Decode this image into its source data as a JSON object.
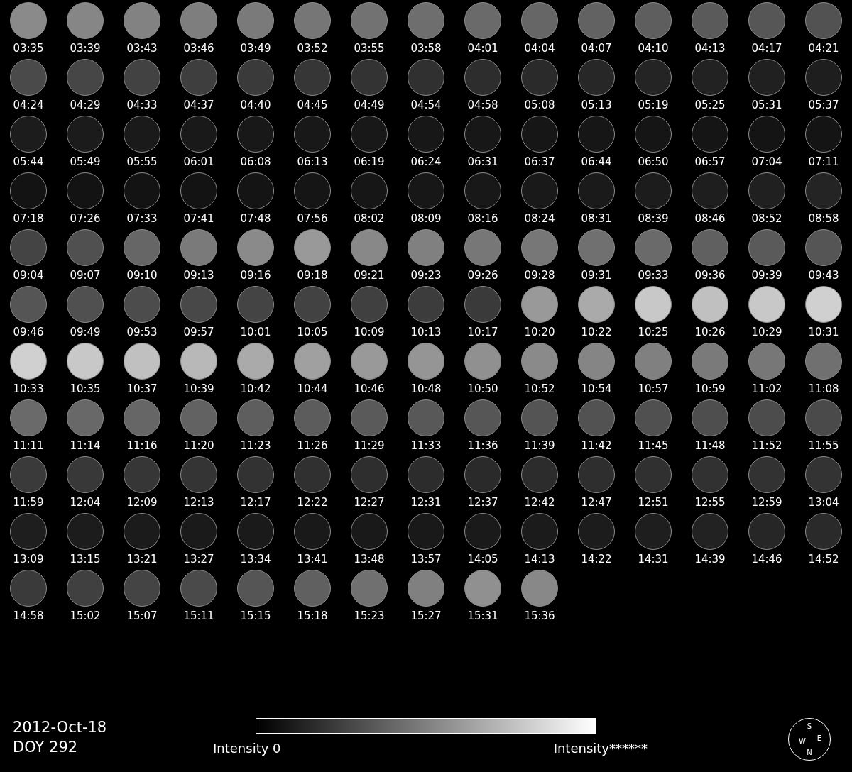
{
  "frames": [
    {
      "time": "03:35",
      "color": "#8a8a8a"
    },
    {
      "time": "03:39",
      "color": "#868686"
    },
    {
      "time": "03:43",
      "color": "#828282"
    },
    {
      "time": "03:46",
      "color": "#7e7e7e"
    },
    {
      "time": "03:49",
      "color": "#7a7a7a"
    },
    {
      "time": "03:52",
      "color": "#767676"
    },
    {
      "time": "03:55",
      "color": "#727272"
    },
    {
      "time": "03:58",
      "color": "#6e6e6e"
    },
    {
      "time": "04:01",
      "color": "#6a6a6a"
    },
    {
      "time": "04:04",
      "color": "#666666"
    },
    {
      "time": "04:07",
      "color": "#626262"
    },
    {
      "time": "04:10",
      "color": "#5e5e5e"
    },
    {
      "time": "04:13",
      "color": "#5a5a5a"
    },
    {
      "time": "04:17",
      "color": "#565656"
    },
    {
      "time": "04:21",
      "color": "#525252"
    },
    {
      "time": "04:24",
      "color": "#4a4a4a"
    },
    {
      "time": "04:29",
      "color": "#464646"
    },
    {
      "time": "04:33",
      "color": "#424242"
    },
    {
      "time": "04:37",
      "color": "#3e3e3e"
    },
    {
      "time": "04:40",
      "color": "#3a3a3a"
    },
    {
      "time": "04:45",
      "color": "#363636"
    },
    {
      "time": "04:49",
      "color": "#333333"
    },
    {
      "time": "04:54",
      "color": "#303030"
    },
    {
      "time": "04:58",
      "color": "#2d2d2d"
    },
    {
      "time": "05:08",
      "color": "#2a2a2a"
    },
    {
      "time": "05:13",
      "color": "#272727"
    },
    {
      "time": "05:19",
      "color": "#242424"
    },
    {
      "time": "05:25",
      "color": "#222222"
    },
    {
      "time": "05:31",
      "color": "#202020"
    },
    {
      "time": "05:37",
      "color": "#1e1e1e"
    },
    {
      "time": "05:44",
      "color": "#1c1c1c"
    },
    {
      "time": "05:49",
      "color": "#1b1b1b"
    },
    {
      "time": "05:55",
      "color": "#1a1a1a"
    },
    {
      "time": "06:01",
      "color": "#191919"
    },
    {
      "time": "06:08",
      "color": "#181818"
    },
    {
      "time": "06:13",
      "color": "#181818"
    },
    {
      "time": "06:19",
      "color": "#181818"
    },
    {
      "time": "06:24",
      "color": "#171717"
    },
    {
      "time": "06:31",
      "color": "#171717"
    },
    {
      "time": "06:37",
      "color": "#161616"
    },
    {
      "time": "06:44",
      "color": "#161616"
    },
    {
      "time": "06:50",
      "color": "#151515"
    },
    {
      "time": "06:57",
      "color": "#151515"
    },
    {
      "time": "07:04",
      "color": "#141414"
    },
    {
      "time": "07:11",
      "color": "#141414"
    },
    {
      "time": "07:18",
      "color": "#131313"
    },
    {
      "time": "07:26",
      "color": "#131313"
    },
    {
      "time": "07:33",
      "color": "#131313"
    },
    {
      "time": "07:41",
      "color": "#131313"
    },
    {
      "time": "07:48",
      "color": "#141414"
    },
    {
      "time": "07:56",
      "color": "#151515"
    },
    {
      "time": "08:02",
      "color": "#161616"
    },
    {
      "time": "08:09",
      "color": "#171717"
    },
    {
      "time": "08:16",
      "color": "#181818"
    },
    {
      "time": "08:24",
      "color": "#191919"
    },
    {
      "time": "08:31",
      "color": "#1a1a1a"
    },
    {
      "time": "08:39",
      "color": "#1c1c1c"
    },
    {
      "time": "08:46",
      "color": "#1e1e1e"
    },
    {
      "time": "08:52",
      "color": "#202020"
    },
    {
      "time": "08:58",
      "color": "#242424"
    },
    {
      "time": "09:04",
      "color": "#444444"
    },
    {
      "time": "09:07",
      "color": "#505050"
    },
    {
      "time": "09:10",
      "color": "#666666"
    },
    {
      "time": "09:13",
      "color": "#7a7a7a"
    },
    {
      "time": "09:16",
      "color": "#8a8a8a"
    },
    {
      "time": "09:18",
      "color": "#999999"
    },
    {
      "time": "09:21",
      "color": "#888888"
    },
    {
      "time": "09:23",
      "color": "#808080"
    },
    {
      "time": "09:26",
      "color": "#777777"
    },
    {
      "time": "09:28",
      "color": "#777777"
    },
    {
      "time": "09:31",
      "color": "#707070"
    },
    {
      "time": "09:33",
      "color": "#6a6a6a"
    },
    {
      "time": "09:36",
      "color": "#606060"
    },
    {
      "time": "09:39",
      "color": "#5a5a5a"
    },
    {
      "time": "09:43",
      "color": "#555555"
    },
    {
      "time": "09:46",
      "color": "#555555"
    },
    {
      "time": "09:49",
      "color": "#505050"
    },
    {
      "time": "09:53",
      "color": "#4c4c4c"
    },
    {
      "time": "09:57",
      "color": "#484848"
    },
    {
      "time": "10:01",
      "color": "#444444"
    },
    {
      "time": "10:05",
      "color": "#424242"
    },
    {
      "time": "10:09",
      "color": "#404040"
    },
    {
      "time": "10:13",
      "color": "#3c3c3c"
    },
    {
      "time": "10:17",
      "color": "#3a3a3a"
    },
    {
      "time": "10:20",
      "color": "#999999"
    },
    {
      "time": "10:22",
      "color": "#aaaaaa"
    },
    {
      "time": "10:25",
      "color": "#c8c8c8"
    },
    {
      "time": "10:26",
      "color": "#c0c0c0"
    },
    {
      "time": "10:29",
      "color": "#c8c8c8"
    },
    {
      "time": "10:31",
      "color": "#d0d0d0"
    },
    {
      "time": "10:33",
      "color": "#d0d0d0"
    },
    {
      "time": "10:35",
      "color": "#c8c8c8"
    },
    {
      "time": "10:37",
      "color": "#c0c0c0"
    },
    {
      "time": "10:39",
      "color": "#b8b8b8"
    },
    {
      "time": "10:42",
      "color": "#aaaaaa"
    },
    {
      "time": "10:44",
      "color": "#a0a0a0"
    },
    {
      "time": "10:46",
      "color": "#999999"
    },
    {
      "time": "10:48",
      "color": "#959595"
    },
    {
      "time": "10:50",
      "color": "#909090"
    },
    {
      "time": "10:52",
      "color": "#8a8a8a"
    },
    {
      "time": "10:54",
      "color": "#858585"
    },
    {
      "time": "10:57",
      "color": "#808080"
    },
    {
      "time": "10:59",
      "color": "#7a7a7a"
    },
    {
      "time": "11:02",
      "color": "#777777"
    },
    {
      "time": "11:08",
      "color": "#707070"
    },
    {
      "time": "11:11",
      "color": "#6a6a6a"
    },
    {
      "time": "11:14",
      "color": "#686868"
    },
    {
      "time": "11:16",
      "color": "#666666"
    },
    {
      "time": "11:20",
      "color": "#626262"
    },
    {
      "time": "11:23",
      "color": "#5e5e5e"
    },
    {
      "time": "11:26",
      "color": "#5c5c5c"
    },
    {
      "time": "11:29",
      "color": "#5a5a5a"
    },
    {
      "time": "11:33",
      "color": "#585858"
    },
    {
      "time": "11:36",
      "color": "#565656"
    },
    {
      "time": "11:39",
      "color": "#545454"
    },
    {
      "time": "11:42",
      "color": "#525252"
    },
    {
      "time": "11:45",
      "color": "#505050"
    },
    {
      "time": "11:48",
      "color": "#4e4e4e"
    },
    {
      "time": "11:52",
      "color": "#4c4c4c"
    },
    {
      "time": "11:55",
      "color": "#4a4a4a"
    },
    {
      "time": "11:59",
      "color": "#3a3a3a"
    },
    {
      "time": "12:04",
      "color": "#383838"
    },
    {
      "time": "12:09",
      "color": "#363636"
    },
    {
      "time": "12:13",
      "color": "#343434"
    },
    {
      "time": "12:17",
      "color": "#323232"
    },
    {
      "time": "12:22",
      "color": "#303030"
    },
    {
      "time": "12:27",
      "color": "#2e2e2e"
    },
    {
      "time": "12:31",
      "color": "#2c2c2c"
    },
    {
      "time": "12:37",
      "color": "#2a2a2a"
    },
    {
      "time": "12:42",
      "color": "#2c2c2c"
    },
    {
      "time": "12:47",
      "color": "#2e2e2e"
    },
    {
      "time": "12:51",
      "color": "#303030"
    },
    {
      "time": "12:55",
      "color": "#313131"
    },
    {
      "time": "12:59",
      "color": "#323232"
    },
    {
      "time": "13:04",
      "color": "#333333"
    },
    {
      "time": "13:09",
      "color": "#1e1e1e"
    },
    {
      "time": "13:15",
      "color": "#1c1c1c"
    },
    {
      "time": "13:21",
      "color": "#1b1b1b"
    },
    {
      "time": "13:27",
      "color": "#1a1a1a"
    },
    {
      "time": "13:34",
      "color": "#1a1a1a"
    },
    {
      "time": "13:41",
      "color": "#191919"
    },
    {
      "time": "13:48",
      "color": "#191919"
    },
    {
      "time": "13:57",
      "color": "#191919"
    },
    {
      "time": "14:05",
      "color": "#1a1a1a"
    },
    {
      "time": "14:13",
      "color": "#1b1b1b"
    },
    {
      "time": "14:22",
      "color": "#1c1c1c"
    },
    {
      "time": "14:31",
      "color": "#1e1e1e"
    },
    {
      "time": "14:39",
      "color": "#222222"
    },
    {
      "time": "14:46",
      "color": "#262626"
    },
    {
      "time": "14:52",
      "color": "#2a2a2a"
    },
    {
      "time": "14:58",
      "color": "#3a3a3a"
    },
    {
      "time": "15:02",
      "color": "#404040"
    },
    {
      "time": "15:07",
      "color": "#444444"
    },
    {
      "time": "15:11",
      "color": "#4a4a4a"
    },
    {
      "time": "15:15",
      "color": "#555555"
    },
    {
      "time": "15:18",
      "color": "#606060"
    },
    {
      "time": "15:23",
      "color": "#707070"
    },
    {
      "time": "15:27",
      "color": "#808080"
    },
    {
      "time": "15:31",
      "color": "#909090"
    },
    {
      "time": "15:36",
      "color": "#888888"
    }
  ],
  "date": "2012-Oct-18",
  "doy": "DOY 292",
  "colorbar": {
    "min_label": "Intensity 0",
    "max_label": "Intensity******"
  },
  "compass": {
    "top": "S",
    "left": "W",
    "right": "E",
    "bottom": "N"
  }
}
